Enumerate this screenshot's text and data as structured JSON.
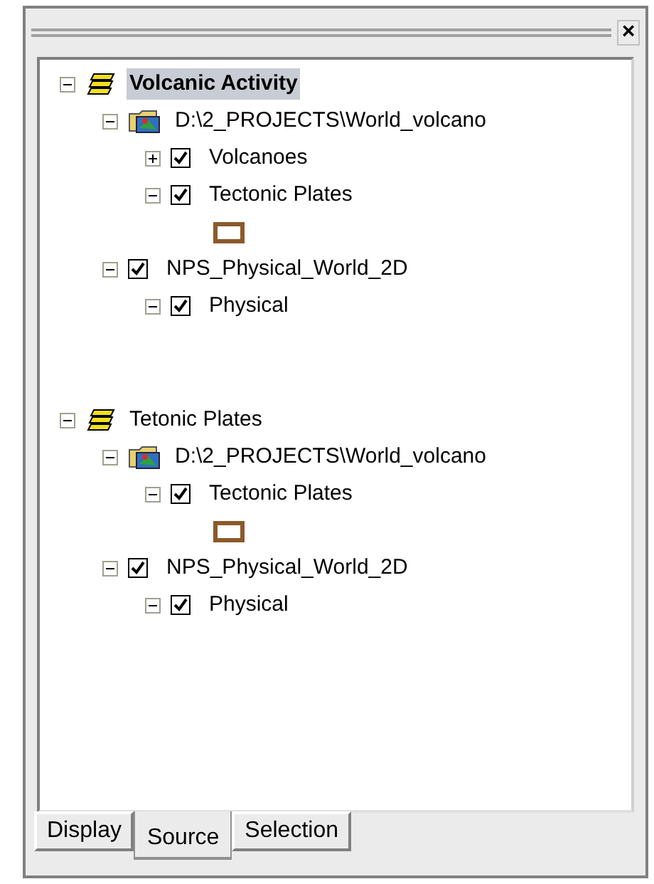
{
  "panel": {
    "close": "×"
  },
  "tree": [
    {
      "kind": "group",
      "label": "Volcanic Activity",
      "selected": true,
      "expanded": true,
      "children": [
        {
          "kind": "source",
          "label": "D:\\2_PROJECTS\\World_volcano",
          "expanded": true,
          "children": [
            {
              "kind": "layer",
              "label": "Volcanoes",
              "checked": true,
              "expanded": false
            },
            {
              "kind": "layer",
              "label": "Tectonic Plates",
              "checked": true,
              "expanded": true,
              "children": [
                {
                  "kind": "legend",
                  "color": "#8b5a2b"
                }
              ]
            }
          ]
        },
        {
          "kind": "layer",
          "label": "NPS_Physical_World_2D",
          "checked": true,
          "expanded": true,
          "children": [
            {
              "kind": "layer",
              "label": "Physical",
              "checked": true,
              "expanded": true
            }
          ]
        }
      ]
    },
    {
      "kind": "group",
      "label": "Tetonic Plates",
      "selected": false,
      "expanded": true,
      "children": [
        {
          "kind": "source",
          "label": "D:\\2_PROJECTS\\World_volcano",
          "expanded": true,
          "children": [
            {
              "kind": "layer",
              "label": "Tectonic Plates",
              "checked": true,
              "expanded": true,
              "children": [
                {
                  "kind": "legend",
                  "color": "#8b5a2b"
                }
              ]
            }
          ]
        },
        {
          "kind": "layer",
          "label": "NPS_Physical_World_2D",
          "checked": true,
          "expanded": true,
          "children": [
            {
              "kind": "layer",
              "label": "Physical",
              "checked": true,
              "expanded": true
            }
          ]
        }
      ]
    }
  ],
  "tabs": [
    {
      "label": "Display",
      "selected": false
    },
    {
      "label": "Source",
      "selected": true
    },
    {
      "label": "Selection",
      "selected": false
    }
  ]
}
